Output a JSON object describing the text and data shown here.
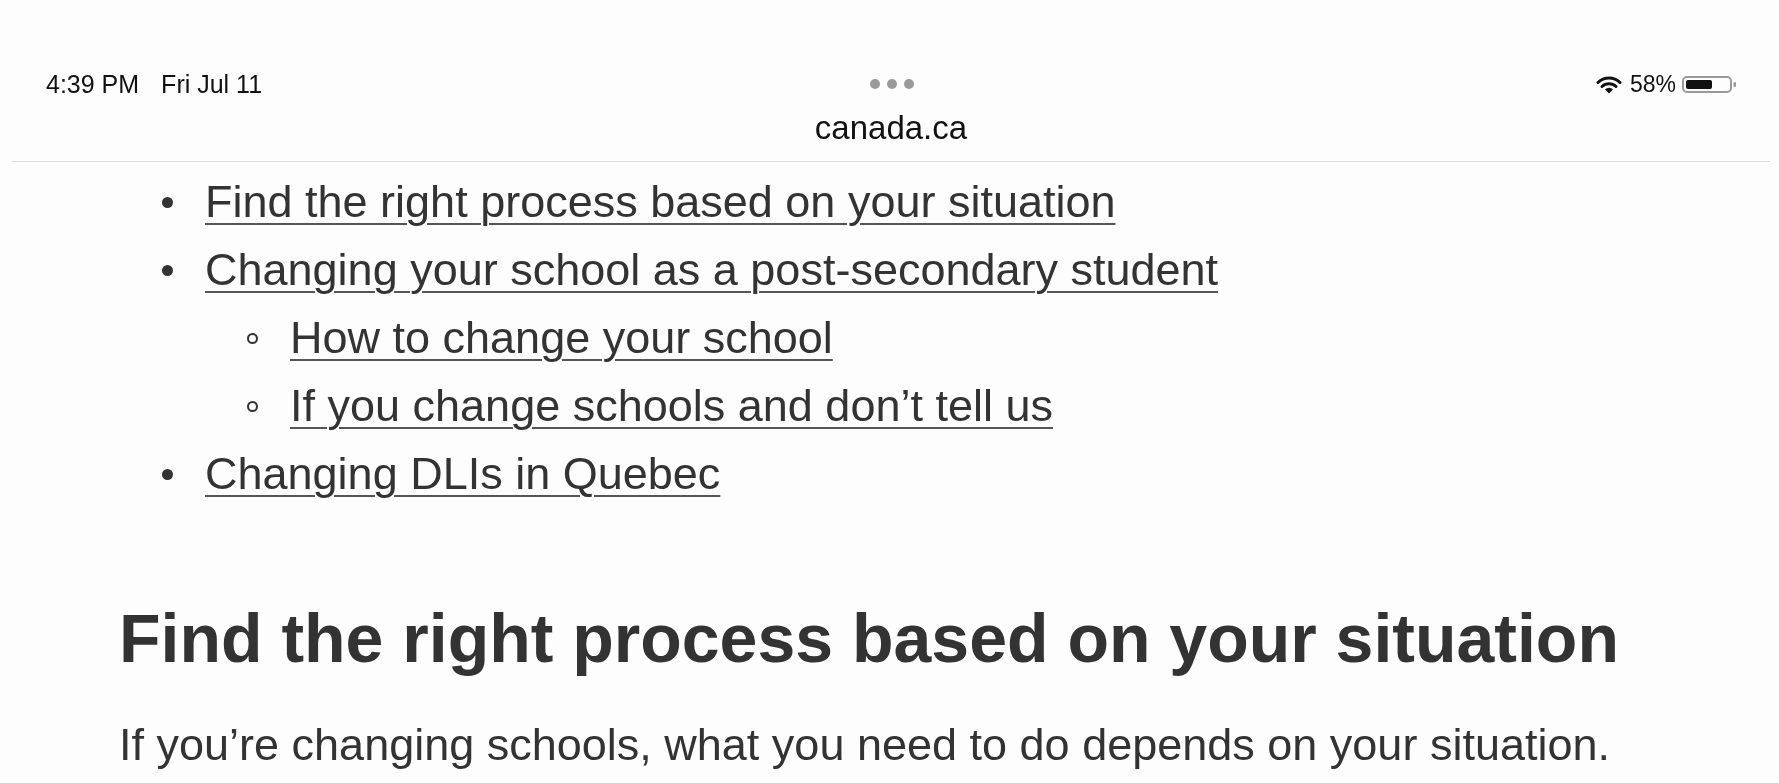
{
  "status_bar": {
    "time": "4:39 PM",
    "date": "Fri Jul 11",
    "battery": "58%"
  },
  "address_bar": {
    "url": "canada.ca"
  },
  "toc": [
    {
      "text": "Find the right process based on your situation"
    },
    {
      "text": "Changing your school as a post-secondary student",
      "children": [
        {
          "text": "How to change your school"
        },
        {
          "text": "If you change schools and don’t tell us"
        }
      ]
    },
    {
      "text": "Changing DLIs in Quebec"
    }
  ],
  "section": {
    "heading": "Find the right process based on your situation",
    "paragraph": "If you’re changing schools, what you need to do depends on your situation."
  }
}
